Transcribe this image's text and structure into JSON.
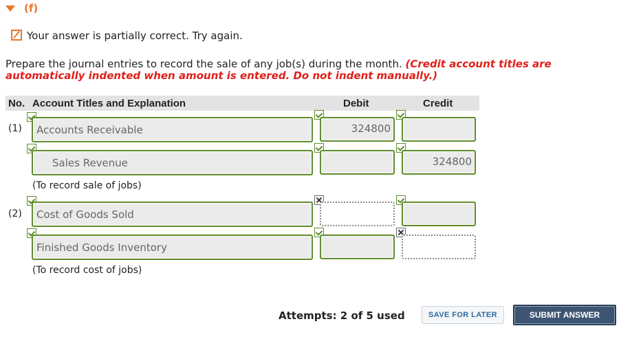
{
  "part": {
    "label": "(f)"
  },
  "feedback": {
    "text": "Your answer is partially correct.  Try again."
  },
  "instructions": {
    "text": "Prepare the journal entries to record the sale of any job(s) during the month. ",
    "emphasis": "(Credit account titles are automatically indented when amount is entered. Do not indent manually.)"
  },
  "table": {
    "headers": {
      "no": "No.",
      "account": "Account Titles and Explanation",
      "debit": "Debit",
      "credit": "Credit"
    },
    "entries": [
      {
        "no": "(1)",
        "lines": [
          {
            "account": "Accounts Receivable",
            "debit": "324800",
            "credit": ""
          },
          {
            "account": "Sales Revenue",
            "debit": "",
            "credit": "324800"
          }
        ],
        "note": "(To record sale of jobs)"
      },
      {
        "no": "(2)",
        "lines": [
          {
            "account": "Cost of Goods Sold",
            "debit": "",
            "credit": ""
          },
          {
            "account": "Finished Goods Inventory",
            "debit": "",
            "credit": ""
          }
        ],
        "note": "(To record cost of jobs)"
      }
    ]
  },
  "footer": {
    "attempts": "Attempts: 2 of 5 used",
    "save_label": "SAVE FOR LATER",
    "submit_label": "SUBMIT ANSWER"
  },
  "colors": {
    "accent": "#e8772e",
    "error": "#e0201b",
    "correct": "#5e8c2b",
    "submit": "#3d5573"
  }
}
